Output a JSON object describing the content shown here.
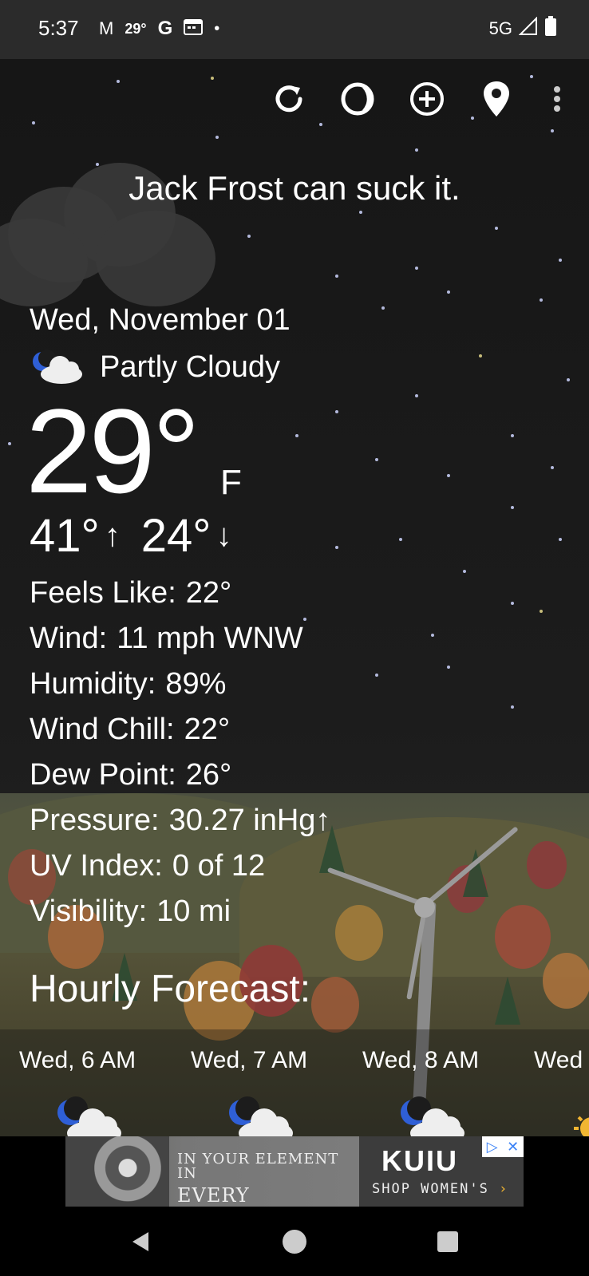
{
  "status_bar": {
    "time": "5:37",
    "icons": [
      "gmail-icon",
      "temperature-icon",
      "google-icon",
      "calendar-icon",
      "dot-icon"
    ],
    "temp": "29°",
    "network": "5G",
    "signal_icon": "signal-icon",
    "battery_icon": "battery-icon"
  },
  "toolbar": {
    "buttons": [
      {
        "name": "refresh-icon"
      },
      {
        "name": "theme-icon"
      },
      {
        "name": "add-location-icon"
      },
      {
        "name": "location-pin-icon"
      },
      {
        "name": "more-options-icon"
      }
    ]
  },
  "quote": "Jack Frost can suck it.",
  "current": {
    "date": "Wed, November 01",
    "condition": "Partly Cloudy",
    "condition_icon": "moon-cloud-icon",
    "temperature": "29°",
    "unit": "F",
    "high": "41°",
    "low": "24°",
    "up_arrow": "↑",
    "down_arrow": "↓"
  },
  "details": [
    {
      "label": "Feels Like:",
      "value": "22°"
    },
    {
      "label": "Wind:",
      "value": "11 mph WNW"
    },
    {
      "label": "Humidity:",
      "value": "89%"
    },
    {
      "label": "Wind Chill:",
      "value": "22°"
    },
    {
      "label": "Dew Point:",
      "value": "26°"
    },
    {
      "label": "Pressure:",
      "value": "30.27 inHg↑"
    },
    {
      "label": "UV Index:",
      "value": "0 of 12"
    },
    {
      "label": "Visibility:",
      "value": "10 mi"
    }
  ],
  "hourly": {
    "title": "Hourly Forecast:",
    "items": [
      {
        "label": "Wed, 6 AM",
        "icon": "moon-cloud-icon"
      },
      {
        "label": "Wed, 7 AM",
        "icon": "moon-cloud-icon"
      },
      {
        "label": "Wed, 8 AM",
        "icon": "moon-cloud-icon"
      },
      {
        "label": "Wed",
        "icon": "sun-icon"
      }
    ]
  },
  "ad": {
    "slogan_line1": "IN YOUR ELEMENT IN",
    "slogan_line2": "EVERY ELEMENT",
    "brand": "KUIU",
    "cta": "SHOP WOMEN'S",
    "cta_arrow": "›",
    "adchoices_icon": "▷",
    "close_icon": "✕",
    "accent_color": "#3b82f6"
  },
  "navigation": {
    "buttons": [
      "back-icon",
      "home-icon",
      "recents-icon"
    ]
  }
}
